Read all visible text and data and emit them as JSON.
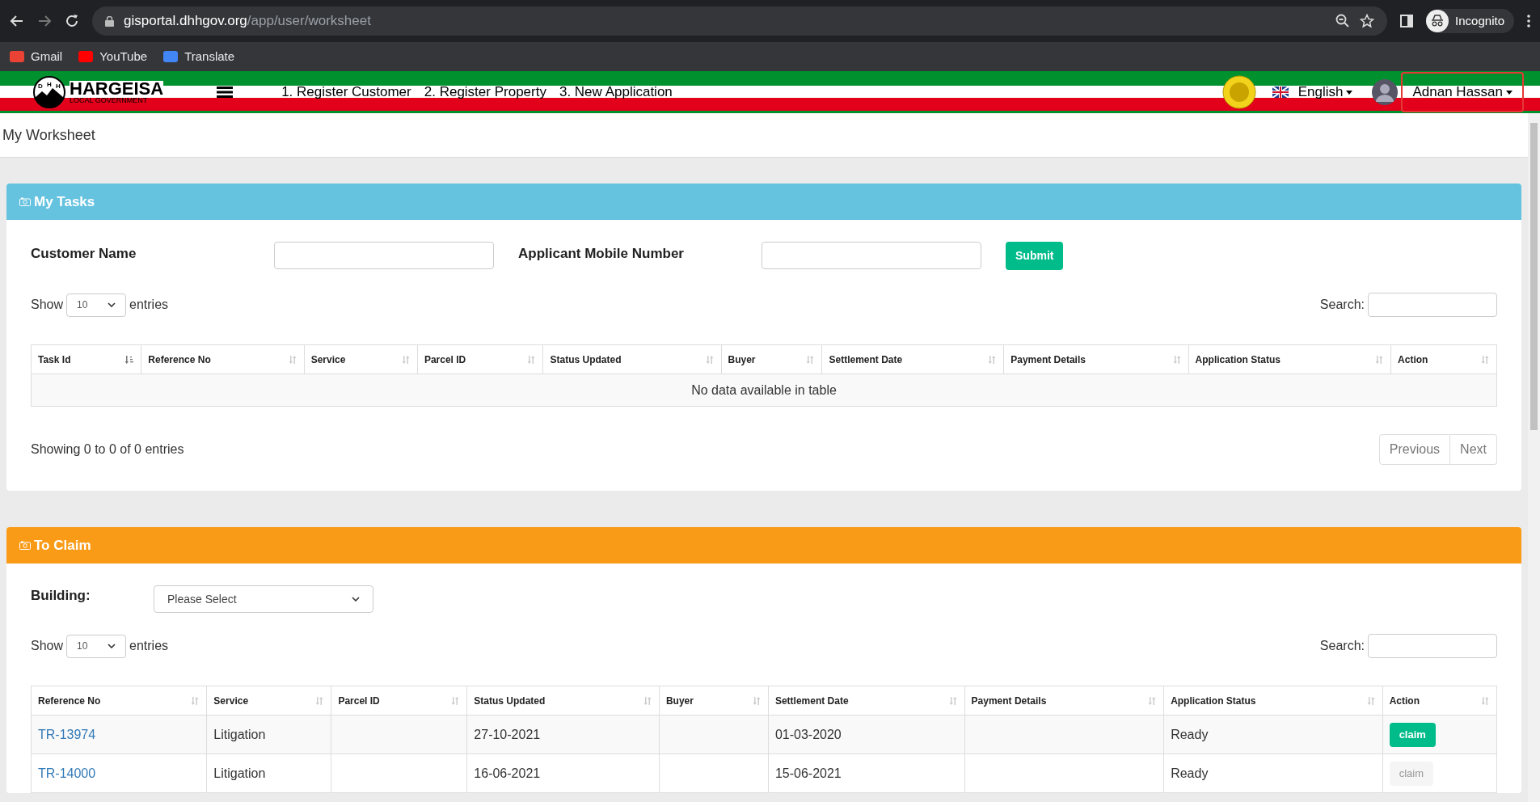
{
  "browser": {
    "url_host": "gisportal.dhhgov.org",
    "url_path": "/app/user/worksheet",
    "profile": "Incognito",
    "bookmarks": [
      "Gmail",
      "YouTube",
      "Translate"
    ]
  },
  "header": {
    "logo_title": "HARGEISA",
    "logo_subtitle": "LOCAL GOVERNMENT",
    "logo_letters": [
      "D",
      "H",
      "H"
    ],
    "nav": [
      "1. Register Customer",
      "2. Register Property",
      "3. New Application"
    ],
    "language": "English",
    "user": "Adnan Hassan",
    "user_highlighted": true
  },
  "page_title": "My Worksheet",
  "my_tasks": {
    "title": "My Tasks",
    "fields": [
      {
        "label": "Customer Name"
      },
      {
        "label": "Applicant Mobile Number"
      }
    ],
    "submit": "Submit",
    "show_label": "Show",
    "page_size": "10",
    "entries_label": "entries",
    "search_label": "Search:",
    "columns": [
      {
        "label": "Task Id",
        "sorted": true
      },
      {
        "label": "Reference No",
        "sorted": false
      },
      {
        "label": "Service",
        "sorted": false
      },
      {
        "label": "Parcel ID",
        "sorted": false
      },
      {
        "label": "Status Updated",
        "sorted": false
      },
      {
        "label": "Buyer",
        "sorted": false
      },
      {
        "label": "Settlement Date",
        "sorted": false
      },
      {
        "label": "Payment Details",
        "sorted": false
      },
      {
        "label": "Application Status",
        "sorted": false
      },
      {
        "label": "Action",
        "sorted": false
      }
    ],
    "empty_text": "No data available in table",
    "info": "Showing 0 to 0 of 0 entries",
    "pager": [
      "Previous",
      "Next"
    ]
  },
  "to_claim": {
    "title": "To Claim",
    "building_label": "Building:",
    "building_placeholder": "Please Select",
    "show_label": "Show",
    "page_size": "10",
    "entries_label": "entries",
    "search_label": "Search:",
    "columns": [
      {
        "label": "Reference No",
        "sorted": false
      },
      {
        "label": "Service",
        "sorted": false
      },
      {
        "label": "Parcel ID",
        "sorted": false
      },
      {
        "label": "Status Updated",
        "sorted": false
      },
      {
        "label": "Buyer",
        "sorted": false
      },
      {
        "label": "Settlement Date",
        "sorted": false
      },
      {
        "label": "Payment Details",
        "sorted": false
      },
      {
        "label": "Application Status",
        "sorted": false
      },
      {
        "label": "Action",
        "sorted": false
      }
    ],
    "rows": [
      {
        "reference": "TR-13974",
        "service": "Litigation",
        "parcel": "",
        "status_updated": "27-10-2021",
        "buyer": "",
        "settlement_date": "01-03-2020",
        "payment": "",
        "app_status": "Ready",
        "action": "claim",
        "action_disabled": false
      },
      {
        "reference": "TR-14000",
        "service": "Litigation",
        "parcel": "",
        "status_updated": "16-06-2021",
        "buyer": "",
        "settlement_date": "15-06-2021",
        "payment": "",
        "app_status": "Ready",
        "action": "claim",
        "action_disabled": true
      }
    ]
  }
}
